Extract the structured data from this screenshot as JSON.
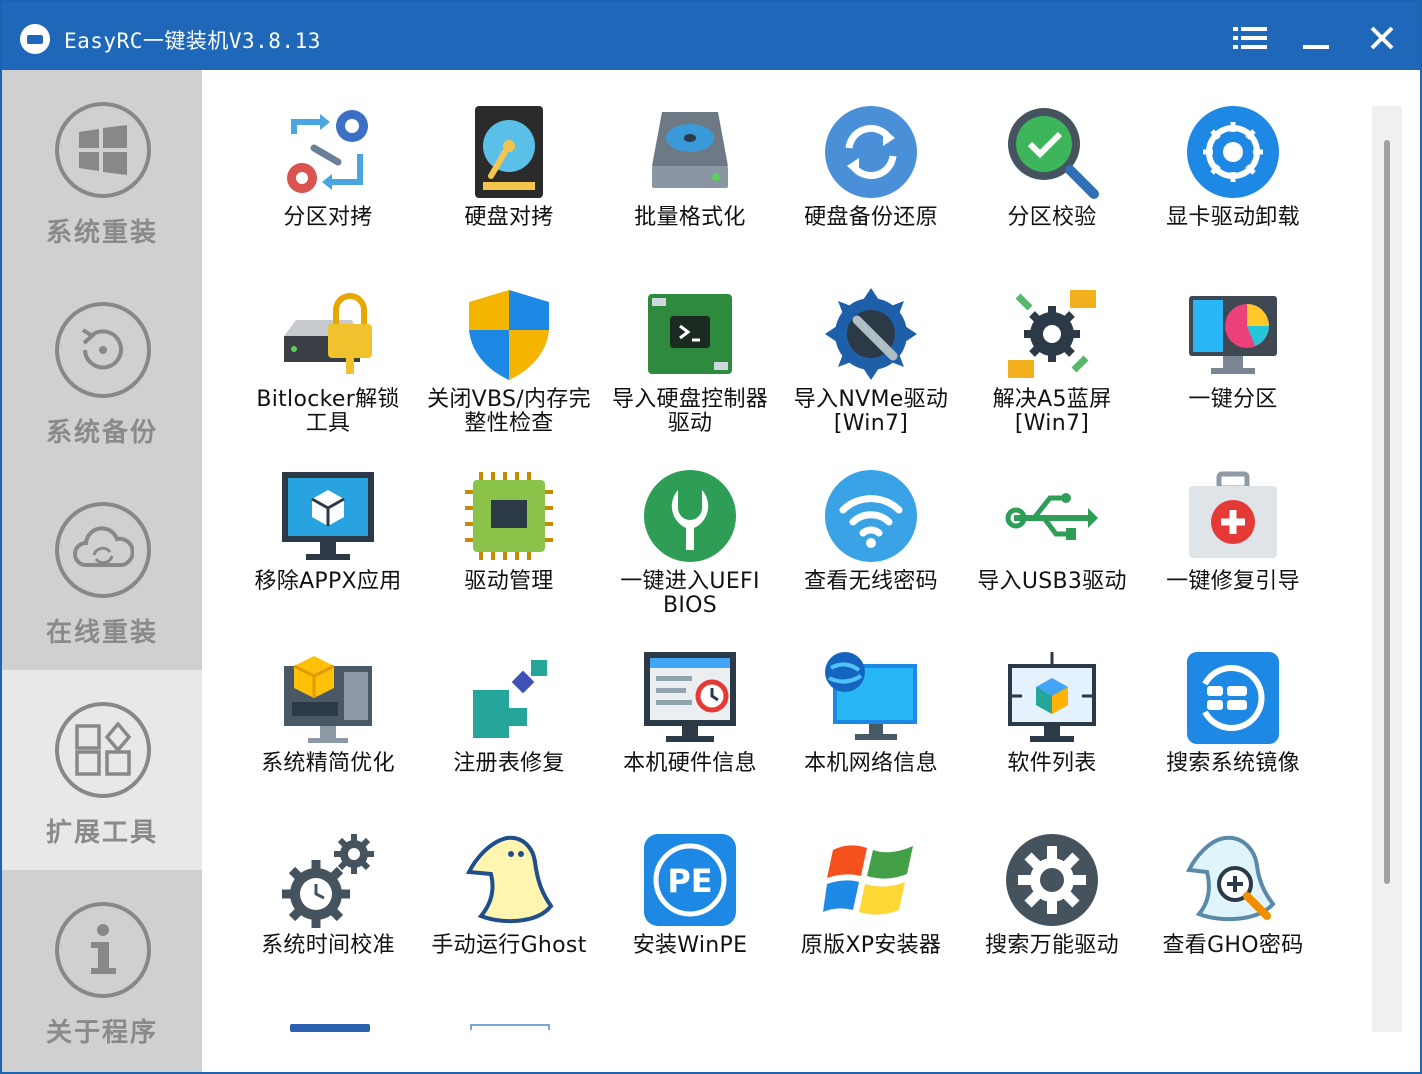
{
  "window": {
    "title": "EasyRC一键装机V3.8.13"
  },
  "titlebar": {
    "menu_icon": "menu-icon",
    "min_icon": "minimize-icon",
    "close_icon": "close-icon"
  },
  "sidebar": {
    "items": [
      {
        "label": "系统重装",
        "icon": "windows-logo-icon",
        "active": false
      },
      {
        "label": "系统备份",
        "icon": "backup-restore-icon",
        "active": false
      },
      {
        "label": "在线重装",
        "icon": "cloud-sync-icon",
        "active": false
      },
      {
        "label": "扩展工具",
        "icon": "apps-grid-icon",
        "active": true
      },
      {
        "label": "关于程序",
        "icon": "info-icon",
        "active": false
      }
    ]
  },
  "tools": [
    {
      "label": "分区对拷",
      "icon": "partition-copy-icon"
    },
    {
      "label": "硬盘对拷",
      "icon": "hard-disk-copy-icon"
    },
    {
      "label": "批量格式化",
      "icon": "batch-format-icon"
    },
    {
      "label": "硬盘备份还原",
      "icon": "disk-backup-restore-icon"
    },
    {
      "label": "分区校验",
      "icon": "partition-check-icon"
    },
    {
      "label": "显卡驱动卸载",
      "icon": "gpu-driver-uninstall-icon"
    },
    {
      "label": "Bitlocker解锁\n工具",
      "icon": "bitlocker-unlock-icon"
    },
    {
      "label": "关闭VBS/内存完\n整性检查",
      "icon": "shield-icon"
    },
    {
      "label": "导入硬盘控制器\n驱动",
      "icon": "disk-controller-icon"
    },
    {
      "label": "导入NVMe驱动\n[Win7]",
      "icon": "nvme-driver-icon"
    },
    {
      "label": "解决A5蓝屏\n[Win7]",
      "icon": "bsod-fix-icon"
    },
    {
      "label": "一键分区",
      "icon": "quick-partition-icon"
    },
    {
      "label": "移除APPX应用",
      "icon": "remove-appx-icon"
    },
    {
      "label": "驱动管理",
      "icon": "driver-manager-icon"
    },
    {
      "label": "一键进入UEFI\nBIOS",
      "icon": "uefi-bios-icon"
    },
    {
      "label": "查看无线密码",
      "icon": "wifi-password-icon"
    },
    {
      "label": "导入USB3驱动",
      "icon": "usb3-driver-icon"
    },
    {
      "label": "一键修复引导",
      "icon": "boot-repair-icon"
    },
    {
      "label": "系统精简优化",
      "icon": "system-optimize-icon"
    },
    {
      "label": "注册表修复",
      "icon": "registry-repair-icon"
    },
    {
      "label": "本机硬件信息",
      "icon": "hardware-info-icon"
    },
    {
      "label": "本机网络信息",
      "icon": "network-info-icon"
    },
    {
      "label": "软件列表",
      "icon": "software-list-icon"
    },
    {
      "label": "搜索系统镜像",
      "icon": "search-system-image-icon"
    },
    {
      "label": "系统时间校准",
      "icon": "time-sync-icon"
    },
    {
      "label": "手动运行Ghost",
      "icon": "ghost-icon"
    },
    {
      "label": "安装WinPE",
      "icon": "winpe-icon"
    },
    {
      "label": "原版XP安装器",
      "icon": "windows-xp-icon"
    },
    {
      "label": "搜索万能驱动",
      "icon": "universal-driver-icon"
    },
    {
      "label": "查看GHO密码",
      "icon": "gho-password-icon"
    }
  ]
}
